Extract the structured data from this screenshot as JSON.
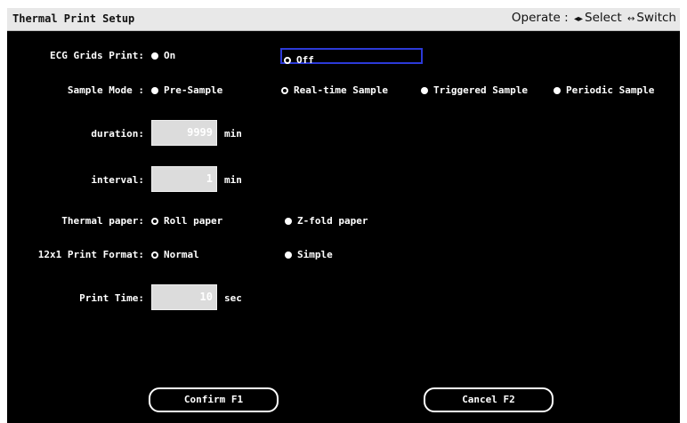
{
  "window": {
    "title": "Thermal Print Setup",
    "hint": {
      "label": "Operate :",
      "select_symbol": "◂▸",
      "select_text": "Select",
      "switch_symbol": "↔",
      "switch_text": "Switch"
    }
  },
  "ecg_grids": {
    "label": "ECG Grids Print:",
    "options": [
      "On",
      "Off"
    ],
    "selected": "Off",
    "focused": "Off"
  },
  "sample_mode": {
    "label": "Sample Mode :",
    "options": [
      "Pre-Sample",
      "Real-time Sample",
      "Triggered Sample",
      "Periodic Sample"
    ],
    "selected": "Real-time Sample"
  },
  "duration": {
    "label": "duration:",
    "value": "9999",
    "unit": "min"
  },
  "interval": {
    "label": "interval:",
    "value": "1",
    "unit": "min"
  },
  "thermal_paper": {
    "label": "Thermal paper:",
    "options": [
      "Roll paper",
      "Z-fold paper"
    ],
    "selected": "Roll paper"
  },
  "print_format": {
    "label": "12x1 Print Format:",
    "options": [
      "Normal",
      "Simple"
    ],
    "selected": "Normal"
  },
  "print_time": {
    "label": "Print Time:",
    "value": "10",
    "unit": "sec"
  },
  "buttons": {
    "confirm": "Confirm F1",
    "cancel": "Cancel F2"
  }
}
